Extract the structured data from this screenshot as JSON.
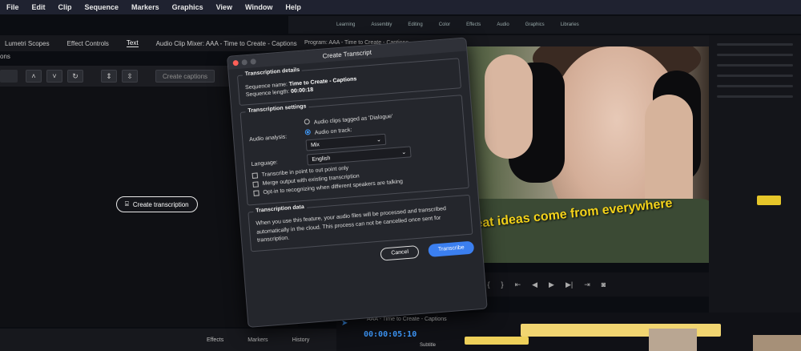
{
  "menu": [
    "File",
    "Edit",
    "Clip",
    "Sequence",
    "Markers",
    "Graphics",
    "View",
    "Window",
    "Help"
  ],
  "workspace_tabs": [
    "Learning",
    "Assembly",
    "Editing",
    "Color",
    "Effects",
    "Audio",
    "Graphics",
    "Libraries"
  ],
  "panels": {
    "lumetri": "Lumetri Scopes",
    "effect_controls": "Effect Controls",
    "text": "Text",
    "audio_mixer": "Audio Clip Mixer: AAA - Time to Create - Captions",
    "program": "Program: AAA - Time to Create - Captions",
    "partial_label": "ons"
  },
  "left": {
    "create_captions": "Create captions",
    "create_transcription": "Create transcription"
  },
  "bottom_tabs": [
    "Effects",
    "Markers",
    "History"
  ],
  "video": {
    "subtitle": "Great ideas come from everywhere"
  },
  "timeline": {
    "title": "AAA - Time to Create - Captions",
    "timecode": "00:00:05:10",
    "track_label": "Subtitle"
  },
  "dialog": {
    "title": "Create Transcript",
    "details_label": "Transcription details",
    "sequence_name_label": "Sequence name:",
    "sequence_name": "Time to Create - Captions",
    "sequence_length_label": "Sequence length:",
    "sequence_length": "00:00:18",
    "settings_label": "Transcription settings",
    "audio_analysis_label": "Audio analysis:",
    "option_dialogue": "Audio clips tagged as 'Dialogue'",
    "option_track": "Audio on track:",
    "track_value": "Mix",
    "language_label": "Language:",
    "language_value": "English",
    "chk_in_out": "Transcribe in point to out point only",
    "chk_merge": "Merge output with existing transcription",
    "chk_speakers": "Opt-in to recognizing when different speakers are talking",
    "data_label": "Transcription data",
    "data_text": "When you use this feature, your audio files will be processed and transcribed automatically in the cloud. This process can not be cancelled once sent for transcription.",
    "cancel": "Cancel",
    "transcribe": "Transcribe"
  },
  "colors": {
    "accent": "#3b7ff0",
    "subtitle": "#f3d21a",
    "timecode": "#3f9bff"
  }
}
